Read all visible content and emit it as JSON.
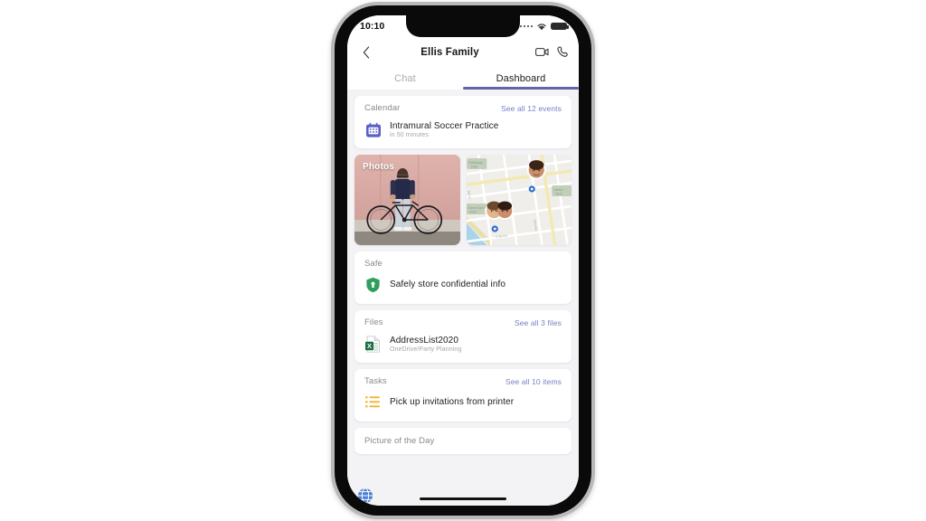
{
  "device": {
    "status_bar": {
      "time": "10:10",
      "signal_icon": "signal-dots-icon",
      "wifi_icon": "wifi-icon",
      "battery_icon": "battery-icon"
    },
    "home_indicator": "home-indicator"
  },
  "header": {
    "back_icon": "chevron-left-icon",
    "title": "Ellis Family",
    "video_call_icon": "video-camera-icon",
    "audio_call_icon": "phone-handset-icon"
  },
  "tabs": [
    {
      "label": "Chat",
      "active": false
    },
    {
      "label": "Dashboard",
      "active": true
    }
  ],
  "cards": {
    "calendar": {
      "title": "Calendar",
      "link": "See all 12 events",
      "icon": "calendar-icon",
      "item_title": "Intramural Soccer Practice",
      "item_sub": "in 50 minutes"
    },
    "photos": {
      "label": "Photos",
      "image_desc": "person-with-bicycle-photo"
    },
    "map": {
      "label": "map-tile",
      "pins": [
        "avatar-pin-single",
        "avatar-pin-pair"
      ]
    },
    "safe": {
      "title": "Safe",
      "icon": "shield-lock-icon",
      "item_title": "Safely store confidential info"
    },
    "files": {
      "title": "Files",
      "link": "See all 3 files",
      "icon": "excel-file-icon",
      "item_title": "AddressList2020",
      "item_sub": "OneDrive/Party Planning"
    },
    "tasks": {
      "title": "Tasks",
      "link": "See all 10 items",
      "icon": "task-list-icon",
      "item_title": "Pick up invitations from printer"
    },
    "picture_of_the_day": {
      "title": "Picture of the Day",
      "icon": "globe-icon"
    }
  },
  "colors": {
    "accent_purple": "#6264a7",
    "link_blue": "#7a7fc4",
    "safe_green": "#2f9e5c",
    "excel_green": "#1d7044",
    "tasks_orange": "#f2b233",
    "background_gray": "#f3f3f5"
  }
}
